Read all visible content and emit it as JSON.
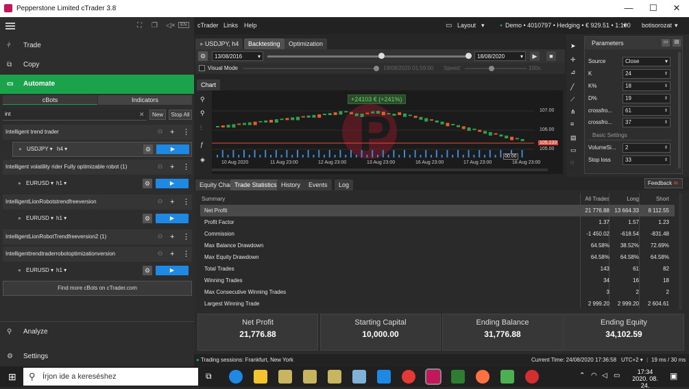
{
  "window": {
    "title": "Pepperstone Limited cTrader 3.8",
    "minimize": "—",
    "maximize": "☐",
    "close": "✕"
  },
  "sidebar": {
    "nav": [
      {
        "label": "Trade"
      },
      {
        "label": "Copy"
      },
      {
        "label": "Automate"
      }
    ],
    "tabs": [
      "cBots",
      "Indicators"
    ],
    "search_value": "int",
    "new_label": "New",
    "stop_all_label": "Stop All",
    "bots": [
      {
        "name": "Intelligent trend trader",
        "symbol": "USDJPY ▾",
        "tf": "h4 ▾"
      },
      {
        "name": "Intelligent volatility rider Fully optimizable robot (1)",
        "symbol": "EURUSD ▾",
        "tf": "h1 ▾"
      },
      {
        "name": "IntelligentLionRobotstrendfreeversion",
        "symbol": "EURUSD ▾",
        "tf": "h1 ▾"
      },
      {
        "name": "IntelligentLionRobotTrendfreeversion2 (1)",
        "symbol": null,
        "tf": null
      },
      {
        "name": "Intelligenttrendtraderrobotoptimizationversion",
        "symbol": "EURUSD ▾",
        "tf": "h1 ▾"
      }
    ],
    "find_more": "Find more cBots on cTrader.com",
    "analyze": "Analyze",
    "settings": "Settings"
  },
  "menubar": {
    "items": [
      "cTrader",
      "Links",
      "Help"
    ],
    "layout": "Layout",
    "account": "Demo • 4010797 • Hedging • € 929.51 • 1:100",
    "user": "botisorozat"
  },
  "backtest": {
    "instance_tab": "USDJPY, h4",
    "tabs": [
      "Backtesting",
      "Optimization"
    ],
    "start_date": "13/08/2016",
    "end_date": "18/08/2020",
    "visual_mode": "Visual Mode",
    "current_time": "19/08/2020 01:59:00",
    "speed_label": "Speed:",
    "speed_value": "100x",
    "chart_tab": "Chart",
    "pnl_badge": "+24103 € (+241%)",
    "price_labels": [
      "107.00",
      "106.00",
      "105.00"
    ],
    "price_marker": "105.233",
    "time_labels": [
      "10 Aug 2020",
      "11 Aug 23:00",
      "12 Aug 23:00",
      "13 Aug 23:00",
      "16 Aug 23:00",
      "17 Aug 23:00",
      "18 Aug 23:00"
    ],
    "time_marker": "00:00"
  },
  "parameters": {
    "title": "Parameters",
    "rows": [
      {
        "label": "Source",
        "value": "Close"
      },
      {
        "label": "K",
        "value": "24"
      },
      {
        "label": "K%",
        "value": "18"
      },
      {
        "label": "D%",
        "value": "19"
      },
      {
        "label": "crossfro...",
        "value": "61"
      },
      {
        "label": "crossfro...",
        "value": "37"
      }
    ],
    "section": "Basic Settings",
    "rows2": [
      {
        "label": "VolumeSi...",
        "value": "2"
      },
      {
        "label": "Stop loss",
        "value": "33"
      }
    ]
  },
  "results": {
    "tabs": [
      "Equity Chart",
      "Trade Statistics",
      "History",
      "Events",
      "Log"
    ],
    "feedback": "Feedback",
    "header": [
      "Summary",
      "All Trades",
      "Long Trades",
      "Short Trades"
    ],
    "rows": [
      [
        "Net Profit",
        "21 776.88",
        "13 664.33",
        "8 112.55"
      ],
      [
        "Profit Factor",
        "1.37",
        "1.57",
        "1.23"
      ],
      [
        "Commission",
        "-1 450.02",
        "-618.54",
        "-831.48"
      ],
      [
        "Max Balance Drawdown",
        "64.58%",
        "38.52%",
        "72.69%"
      ],
      [
        "Max Equity Drawdown",
        "64.58%",
        "64.58%",
        "64.58%"
      ],
      [
        "Total Trades",
        "143",
        "61",
        "82"
      ],
      [
        "Winning Trades",
        "34",
        "16",
        "18"
      ],
      [
        "Max Consecutive Winning Trades",
        "3",
        "2",
        "2"
      ],
      [
        "Largest Winning Trade",
        "2 999.20",
        "2 999.20",
        "2 604.61"
      ]
    ],
    "cards": [
      {
        "title": "Net Profit",
        "value": "21,776.88"
      },
      {
        "title": "Starting Capital",
        "value": "10,000.00"
      },
      {
        "title": "Ending Balance",
        "value": "31,776.88"
      },
      {
        "title": "Ending Equity",
        "value": "34,102.59"
      }
    ]
  },
  "statusbar": {
    "sessions": "Trading sessions: Frankfurt, New York",
    "current_time": "Current Time: 24/08/2020 17:36:58",
    "tz": "UTC+2 ▾",
    "latency": "19 ms / 30 ms"
  },
  "taskbar": {
    "search_placeholder": "Írjon ide a kereséshez",
    "time": "17:34",
    "date": "2020. 08. 24."
  }
}
